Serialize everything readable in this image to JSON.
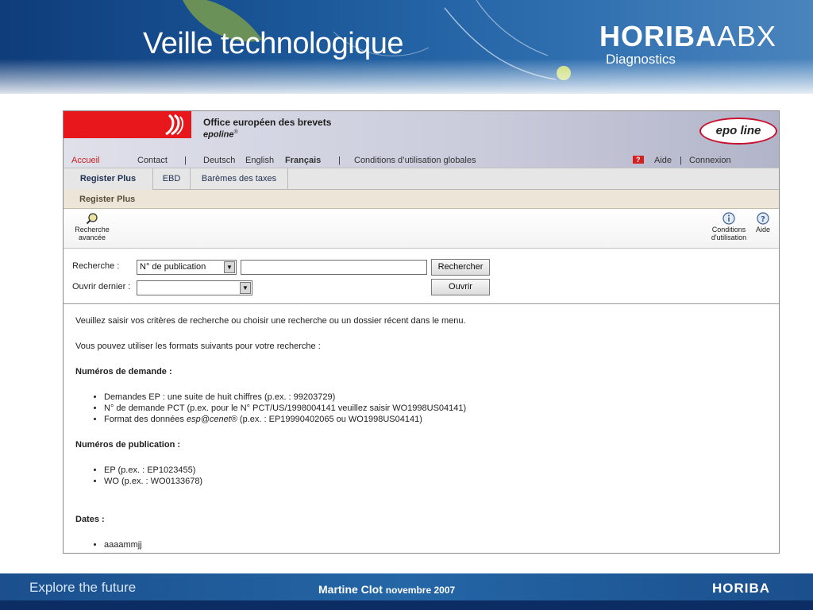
{
  "slide": {
    "title": "Veille technologique",
    "brand": {
      "main": "HORIBA",
      "suffix": "ABX",
      "sub": "Diagnostics"
    },
    "footer": {
      "tagline": "Explore the future",
      "author": "Martine Clot",
      "date": "novembre 2007",
      "logo": "HORIBA"
    }
  },
  "site": {
    "office_name": "Office européen des brevets",
    "product_name": "epoline",
    "product_mark": "®",
    "logo": "epo line",
    "nav": {
      "home": "Accueil",
      "contact": "Contact",
      "lang_de": "Deutsch",
      "lang_en": "English",
      "lang_fr": "Français",
      "terms": "Conditions d’utilisation globales",
      "help_badge": "?",
      "help": "Aide",
      "login": "Connexion"
    },
    "tabs": [
      {
        "label": "Register Plus",
        "active": true
      },
      {
        "label": "EBD",
        "active": false
      },
      {
        "label": "Barèmes des taxes",
        "active": false
      }
    ],
    "section_title": "Register Plus",
    "toolbar": {
      "advanced_line1": "Recherche",
      "advanced_line2": "avancée",
      "conditions_line1": "Conditions",
      "conditions_line2": "d'utilisation",
      "help": "Aide"
    },
    "search": {
      "label": "Recherche :",
      "type_selected": "N° de publication",
      "query_value": "",
      "search_button": "Rechercher",
      "open_label": "Ouvrir dernier :",
      "open_selected": "",
      "open_button": "Ouvrir"
    },
    "content": {
      "intro": "Veuillez saisir vos critères de recherche ou choisir une recherche ou un dossier récent dans le menu.",
      "formats_intro": "Vous pouvez utiliser les formats suivants pour votre recherche :",
      "application_heading": "Numéros de demande :",
      "application_items": [
        "Demandes EP : une suite de huit chiffres (p.ex. : 99203729)",
        "N° de demande PCT (p.ex. pour le N° PCT/US/1998004141 veuillez saisir WO1998US04141)"
      ],
      "format_item_prefix": "Format des données ",
      "format_item_em": "esp@cenet®",
      "format_item_suffix": " (p.ex. : EP19990402065 ou WO1998US04141)",
      "publication_heading": "Numéros de publication :",
      "publication_items": [
        "EP (p.ex. : EP1023455)",
        "WO (p.ex. : WO0133678)"
      ],
      "dates_heading": "Dates :",
      "dates_items": [
        "aaaammjj"
      ]
    }
  }
}
